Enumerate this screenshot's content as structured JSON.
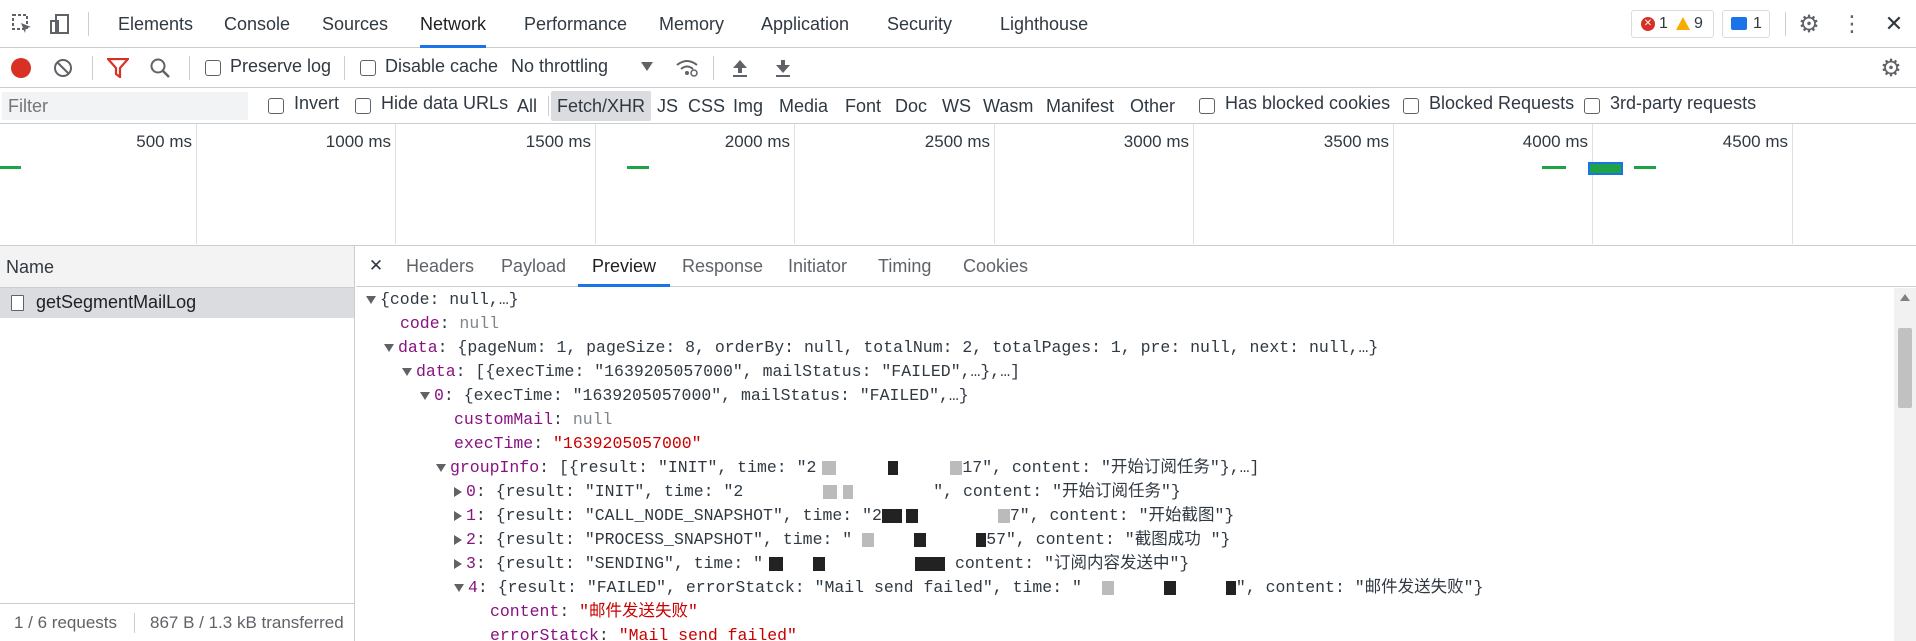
{
  "tabs": [
    "Elements",
    "Console",
    "Sources",
    "Network",
    "Performance",
    "Memory",
    "Application",
    "Security",
    "Lighthouse"
  ],
  "active_tab": "Network",
  "badges": {
    "errors": "1",
    "warnings": "9",
    "messages": "1"
  },
  "toolbar": {
    "preserve_log": "Preserve log",
    "disable_cache": "Disable cache",
    "throttling": "No throttling"
  },
  "filter": {
    "placeholder": "Filter",
    "invert": "Invert",
    "hide_data_urls": "Hide data URLs",
    "types": [
      "All",
      "Fetch/XHR",
      "JS",
      "CSS",
      "Img",
      "Media",
      "Font",
      "Doc",
      "WS",
      "Wasm",
      "Manifest",
      "Other"
    ],
    "active_type": "Fetch/XHR",
    "has_blocked_cookies": "Has blocked cookies",
    "blocked_requests": "Blocked Requests",
    "third_party": "3rd-party requests"
  },
  "overview": {
    "ticks": [
      "500 ms",
      "1000 ms",
      "1500 ms",
      "2000 ms",
      "2500 ms",
      "3000 ms",
      "3500 ms",
      "4000 ms",
      "4500 ms"
    ]
  },
  "name_panel": {
    "header": "Name",
    "request": "getSegmentMailLog",
    "status_requests": "1 / 6 requests",
    "status_transferred": "867 B / 1.3 kB transferred"
  },
  "detail_tabs": [
    "Headers",
    "Payload",
    "Preview",
    "Response",
    "Initiator",
    "Timing",
    "Cookies"
  ],
  "active_detail_tab": "Preview",
  "preview": {
    "root": "{code: null,…}",
    "code_key": "code",
    "code_val": "null",
    "data_key": "data",
    "data_summary": "{pageNum: 1, pageSize: 8, orderBy: null, totalNum: 2, totalPages: 1, pre: null, next: null,…}",
    "data2_key": "data",
    "data2_summary": "[{execTime: \"1639205057000\", mailStatus: \"FAILED\",…},…]",
    "item0_key": "0",
    "item0_summary": "{execTime: \"1639205057000\", mailStatus: \"FAILED\",…}",
    "custommail_key": "customMail",
    "custommail_val": "null",
    "exectime_key": "execTime",
    "exectime_val": "\"1639205057000\"",
    "groupinfo_key": "groupInfo",
    "groupinfo_summary_a": "[{result: \"INIT\", time: \"2",
    "groupinfo_summary_b": "17\", content: \"开始订阅任务\"},…]",
    "g0_key": "0",
    "g0_a": "{result: \"INIT\", time: \"2",
    "g0_b": "\", content: \"开始订阅任务\"}",
    "g1_key": "1",
    "g1_a": "{result: \"CALL_NODE_SNAPSHOT\", time: \"2",
    "g1_b": "7\", content: \"开始截图\"}",
    "g2_key": "2",
    "g2_a": "{result: \"PROCESS_SNAPSHOT\", time: \"",
    "g2_b": "57\", content: \"截图成功 \"}",
    "g3_key": "3",
    "g3_a": "{result: \"SENDING\", time: \"",
    "g3_b": " content: \"订阅内容发送中\"}",
    "g4_key": "4",
    "g4_a": "{result: \"FAILED\", errorStatck: \"Mail send failed\", time: \"",
    "g4_b": "\", content: \"邮件发送失败\"}",
    "content_key": "content",
    "content_val": "\"邮件发送失败\"",
    "errorstatck_key": "errorStatck",
    "errorstatck_val": "\"Mail send failed\""
  }
}
